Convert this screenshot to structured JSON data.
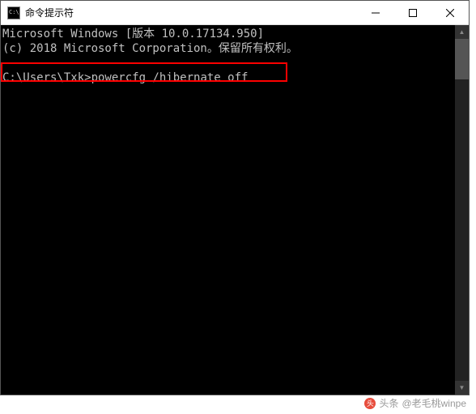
{
  "titlebar": {
    "title": "命令提示符"
  },
  "terminal": {
    "line1": "Microsoft Windows [版本 10.0.17134.950]",
    "line2": "(c) 2018 Microsoft Corporation。保留所有权利。",
    "prompt": "C:\\Users\\Txk>",
    "command": "powercfg /hibernate off"
  },
  "watermark": {
    "prefix": "头条",
    "handle": "@老毛桃winpe"
  }
}
